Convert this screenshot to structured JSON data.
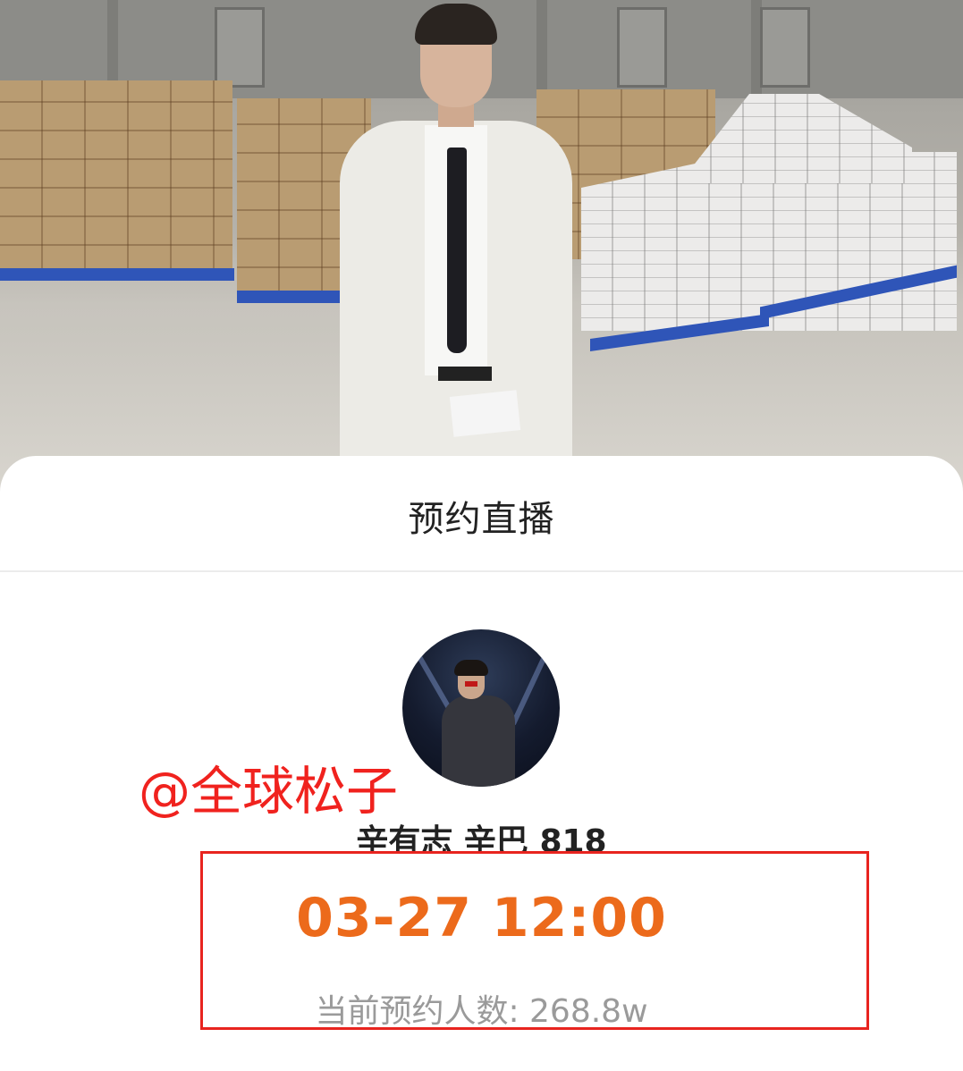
{
  "sheet": {
    "title": "预约直播"
  },
  "streamer": {
    "name": "辛有志 辛巴 818"
  },
  "watermark": {
    "text": "@全球松子"
  },
  "live": {
    "datetime": "03-27 12:00",
    "count_label": "当前预约人数: 268.8w"
  },
  "colors": {
    "accent_orange": "#ec6a1b",
    "highlight_red": "#e8241f",
    "watermark_red": "#f0221e"
  }
}
